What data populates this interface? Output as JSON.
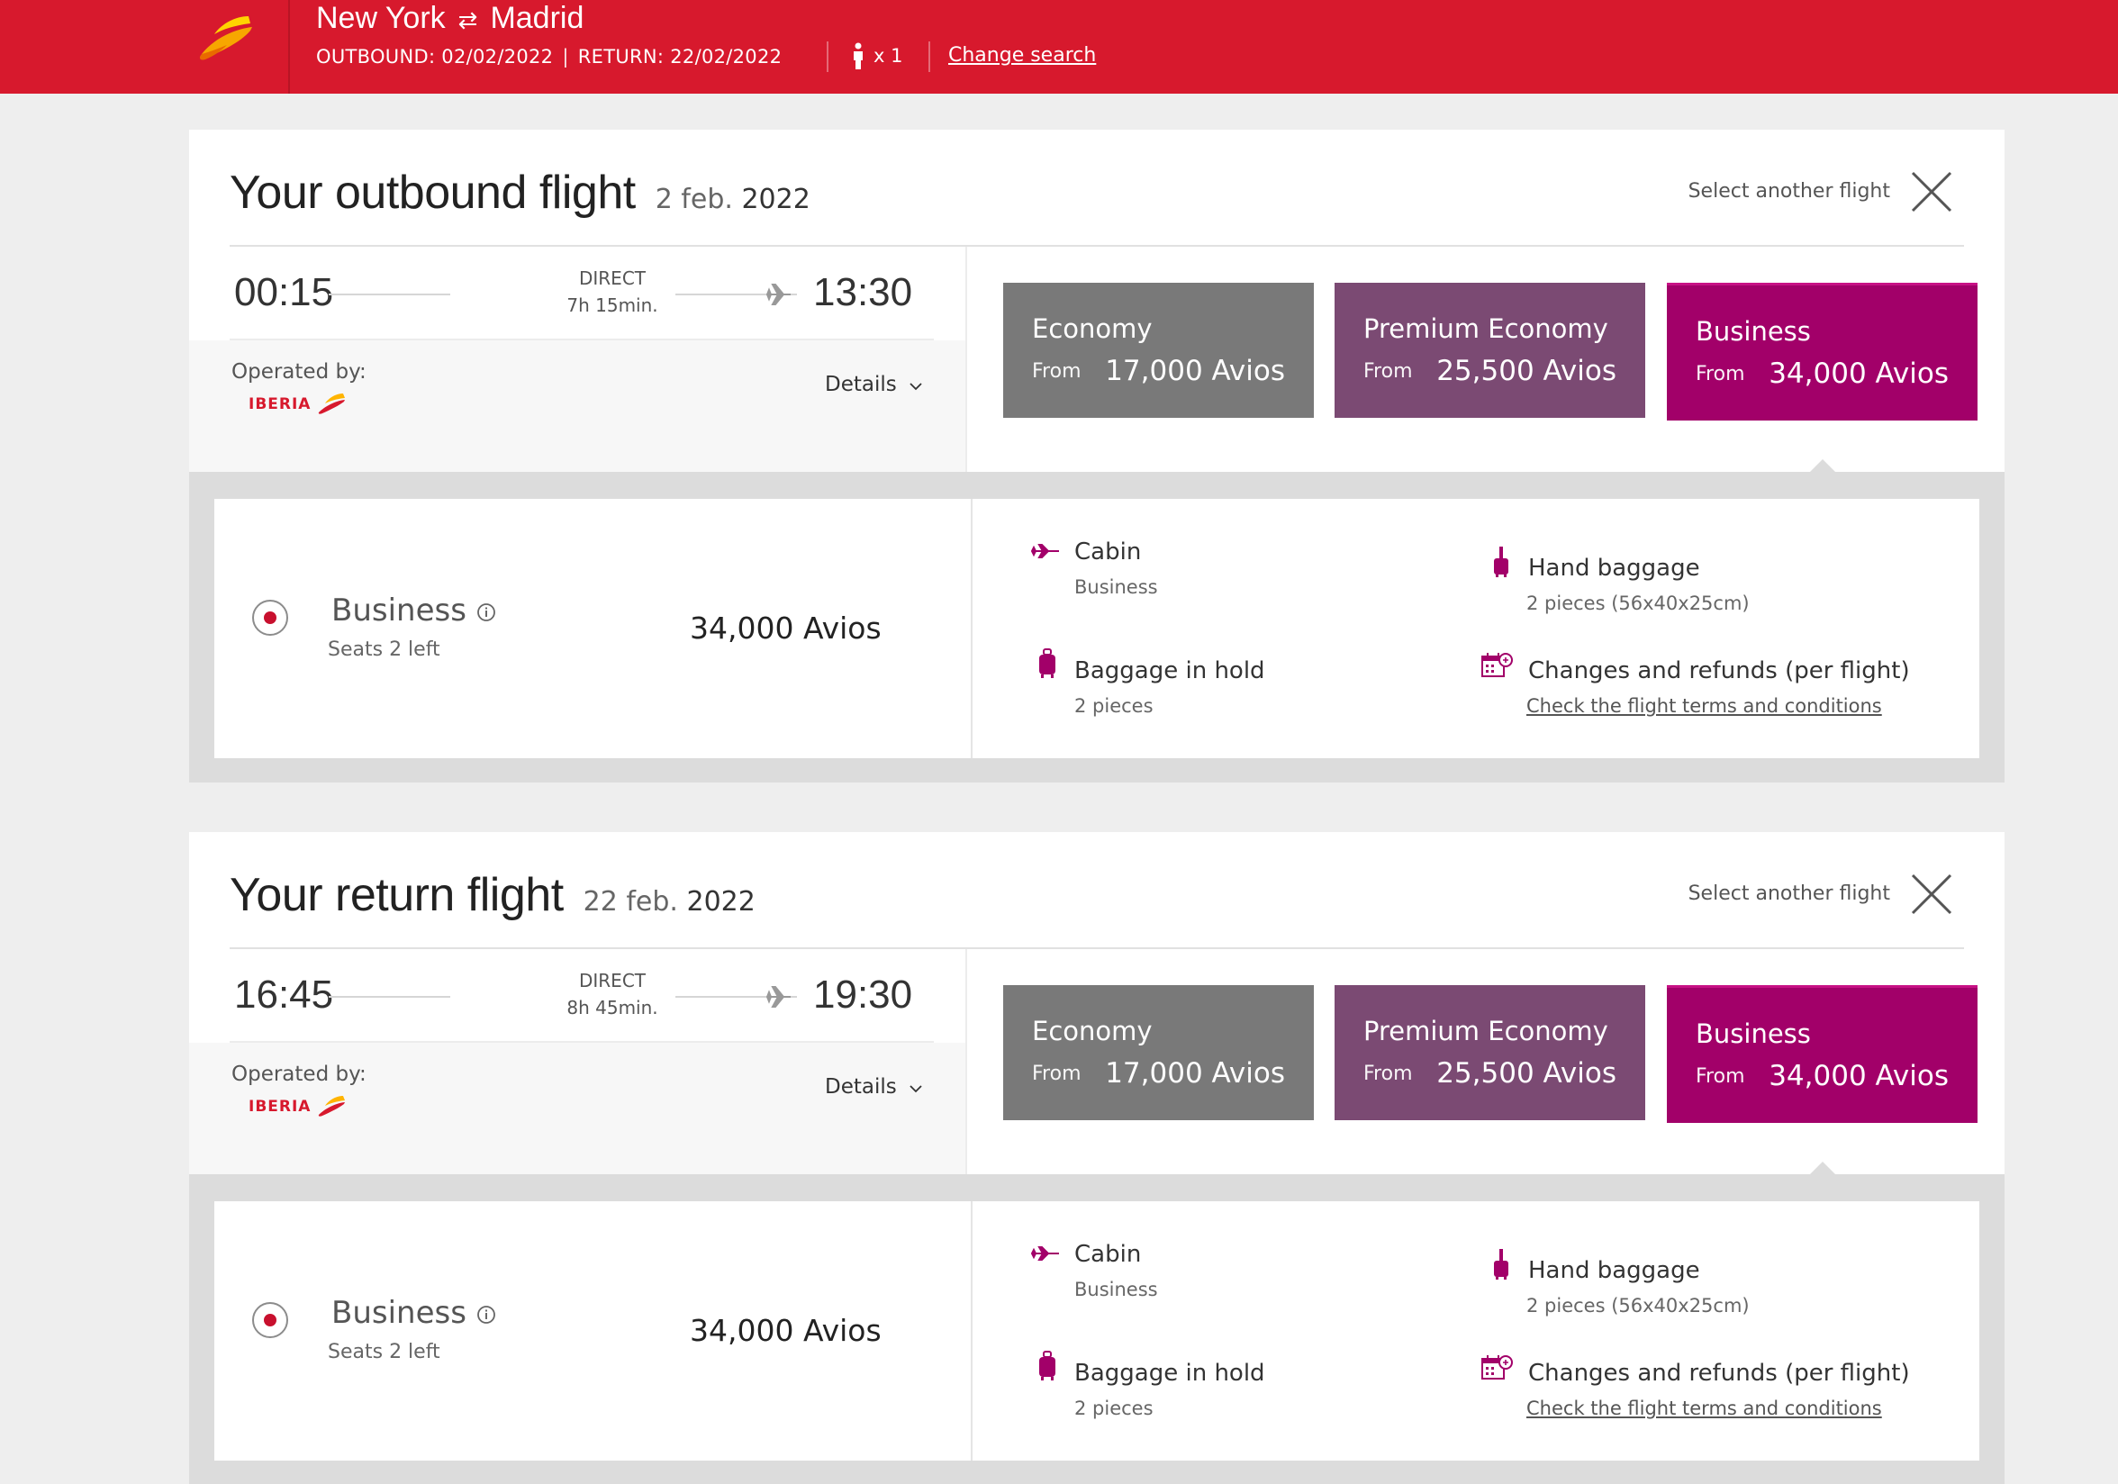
{
  "header": {
    "origin": "New York",
    "swap_glyph": "⇄",
    "destination": "Madrid",
    "outbound_label": "OUTBOUND: 02/02/2022",
    "separator": "|",
    "return_label": "RETURN: 22/02/2022",
    "passengers": "x 1",
    "change_search": "Change search"
  },
  "flights": [
    {
      "title": "Your outbound flight",
      "date_day": "2 feb.",
      "date_year": "2022",
      "select_another": "Select another flight",
      "depart": "00:15",
      "arrive": "13:30",
      "direct": "DIRECT",
      "duration": "7h 15min.",
      "operated_by": "Operated by:",
      "details": "Details",
      "fares": [
        {
          "name": "Economy",
          "from": "From",
          "price": "17,000 Avios"
        },
        {
          "name": "Premium Economy",
          "from": "From",
          "price": "25,500 Avios"
        },
        {
          "name": "Business",
          "from": "From",
          "price": "34,000 Avios"
        }
      ],
      "selected": {
        "cabin_class": "Business",
        "seats_left": "Seats 2 left",
        "price": "34,000 Avios"
      },
      "features": {
        "cabin_title": "Cabin",
        "cabin_value": "Business",
        "hand_title": "Hand baggage",
        "hand_value": "2 pieces (56x40x25cm)",
        "hold_title": "Baggage in hold",
        "hold_value": "2 pieces",
        "changes_title": "Changes and refunds (per flight)",
        "changes_link": "Check the flight terms and conditions"
      }
    },
    {
      "title": "Your return flight",
      "date_day": "22 feb.",
      "date_year": "2022",
      "select_another": "Select another flight",
      "depart": "16:45",
      "arrive": "19:30",
      "direct": "DIRECT",
      "duration": "8h 45min.",
      "operated_by": "Operated by:",
      "details": "Details",
      "fares": [
        {
          "name": "Economy",
          "from": "From",
          "price": "17,000 Avios"
        },
        {
          "name": "Premium Economy",
          "from": "From",
          "price": "25,500 Avios"
        },
        {
          "name": "Business",
          "from": "From",
          "price": "34,000 Avios"
        }
      ],
      "selected": {
        "cabin_class": "Business",
        "seats_left": "Seats 2 left",
        "price": "34,000 Avios"
      },
      "features": {
        "cabin_title": "Cabin",
        "cabin_value": "Business",
        "hand_title": "Hand baggage",
        "hand_value": "2 pieces (56x40x25cm)",
        "hold_title": "Baggage in hold",
        "hold_value": "2 pieces",
        "changes_title": "Changes and refunds (per flight)",
        "changes_link": "Check the flight terms and conditions"
      }
    }
  ],
  "logo_text": "IBERIA",
  "colors": {
    "header_red": "#d7192d",
    "economy": "#797979",
    "premium": "#7b4a73",
    "business": "#a20069"
  }
}
